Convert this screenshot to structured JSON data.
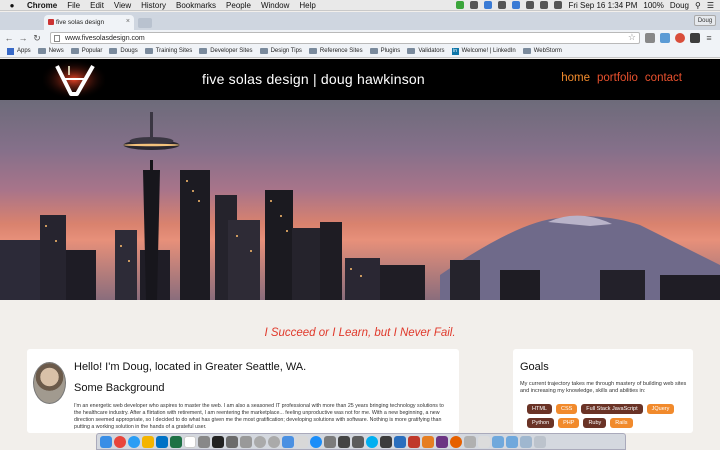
{
  "menubar": {
    "app": "Chrome",
    "items": [
      "File",
      "Edit",
      "View",
      "History",
      "Bookmarks",
      "People",
      "Window",
      "Help"
    ],
    "datetime": "Fri Sep 16  1:34 PM",
    "battery": "100%",
    "user": "Doug"
  },
  "browser": {
    "tab_title": "five solas design",
    "profile": "Doug",
    "url": "www.fivesolasdesign.com",
    "bookmarks": [
      "Apps",
      "News",
      "Popular",
      "Dougs",
      "Training Sites",
      "Developer Sites",
      "Design Tips",
      "Reference Sites",
      "Plugins",
      "Validators",
      "Welcome! | LinkedIn",
      "WebStorm"
    ]
  },
  "site": {
    "title": "five solas design | doug hawkinson",
    "nav": [
      "home",
      "portfolio",
      "contact"
    ],
    "tagline": "I Succeed or I Learn, but I Never Fail.",
    "intro_heading": "Hello! I'm Doug, located in Greater Seattle, WA.",
    "background_heading": "Some Background",
    "bio": "I'm an energetic web developer who aspires to master the web. I am also a seasoned IT professional with more than 25 years bringing technology solutions to the healthcare industry. After a flirtation with retirement, I am reentering the marketplace... feeling unproductive was not for me. With a new beginning, a new direction seemed appropriate, so I decided to do what has given me the most gratification; developing solutions with software. Nothing is more gratifying than putting a working solution in the hands of a grateful user.",
    "goals_heading": "Goals",
    "goals_text": "My current trajectory takes me through mastery of building web sites and increasing my knowledge, skills and abilities in:",
    "skills": [
      "HTML",
      "CSS",
      "Full Stack JavaScript",
      "JQuery",
      "Python",
      "PHP",
      "Ruby",
      "Rails"
    ]
  },
  "colors": {
    "accent_orange": "#f58d2d",
    "accent_red": "#e9512e",
    "skill_dark": "#6a3326",
    "skill_orange": "#f18a2c"
  }
}
